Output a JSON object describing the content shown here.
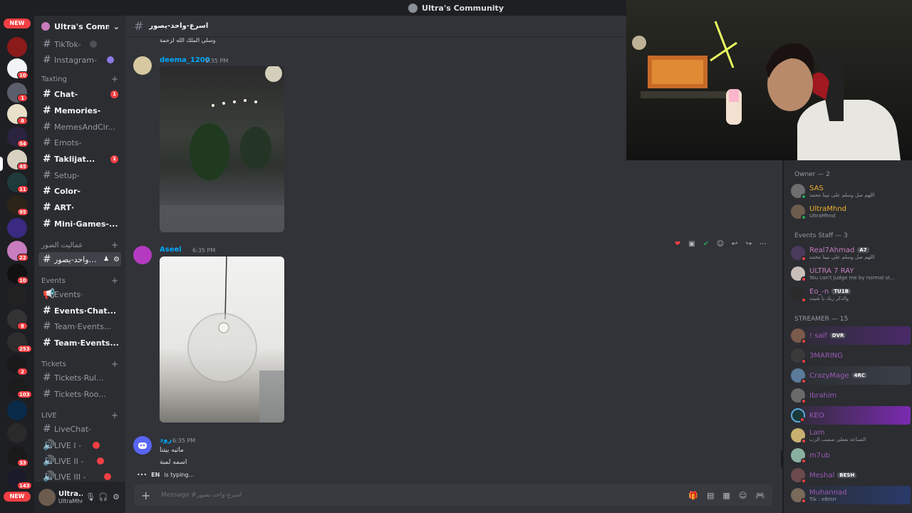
{
  "window": {
    "title": "Ultra's Community"
  },
  "rail": {
    "new_label": "NEW",
    "badges": [
      "10",
      "1",
      "8",
      "54",
      "45",
      "11",
      "95",
      "22",
      "10",
      "8",
      "253",
      "2",
      "103",
      "33",
      "143"
    ]
  },
  "server": {
    "name": "Ultra's Comm..."
  },
  "channels": {
    "tiktok": "TikTok-",
    "instagram": "Instagram-",
    "cat_texting": "Taxting",
    "chat": "Chat-",
    "chat_badge": "1",
    "memories": "Memories-",
    "memes": "MemesAndCir...",
    "emots": "Emots-",
    "taklijat": "Taklijat...",
    "taklijat_badge": "1",
    "setup": "Setup-",
    "color": "Color-",
    "art": "ART·",
    "mini_games": "Mini·Games-...",
    "cat_photos": "عماليت الصور",
    "active_channel": "اسرع-واحد-يصور",
    "cat_events": "Events",
    "events": "Events·",
    "events_chat": "Events·Chat...",
    "team_events_1": "Team·Events...",
    "team_events_2": "Team·Events...",
    "cat_tickets": "Tickets",
    "tickets_rules": "Tickets·Rul...",
    "tickets_room": "Tickets·Roo...",
    "cat_live": "LIVE",
    "livechat": "LiveChat-",
    "live1": "LIVE I -",
    "live2": "LIVE II -",
    "live3": "LIVE III -"
  },
  "user": {
    "display": "Ultra...",
    "username": "UltraMhnd"
  },
  "channel_header": {
    "name": "اسرع-واحد-يصور"
  },
  "messages": {
    "prev_text": "وسلي الملك الله لزحمة",
    "m1": {
      "author": "deema_1200",
      "time": "6:35 PM"
    },
    "m2": {
      "author": "Aseel",
      "time": "6:35 PM"
    },
    "m3": {
      "author": "زود",
      "time": "6:35 PM",
      "line1": "ماتيه بيتنا",
      "line2": "اسمه لمبة"
    }
  },
  "typing": {
    "who": "EN",
    "text": "is typing..."
  },
  "composer": {
    "placeholder": "Message #اسرع-واحد-يصور"
  },
  "members": {
    "owner_header": "Owner — 2",
    "owner": [
      {
        "name": "SAS",
        "status": "اللهم صل وسلم على نبينا محمد",
        "color": "#f0b232"
      },
      {
        "name": "UltraMhnd",
        "status": "UltraMhnd",
        "color": "#f0b232"
      }
    ],
    "staff_header": "Events Staff — 3",
    "staff": [
      {
        "name": "Real7Ahmad",
        "tag": "A7",
        "status": "اللهم صل وسلم على نبينا محمد",
        "color": "#c77dbe"
      },
      {
        "name": "ULTRA 7 RAY",
        "status": "You can't judge me by normal st...",
        "color": "#c77dbe"
      },
      {
        "name": "Eo_-n",
        "tag": "TU1B",
        "status": "والذكر ربك يا شيت",
        "color": "#c77dbe"
      }
    ],
    "streamer_header": "STREAMER — 15",
    "streamers": [
      {
        "name": "! saif",
        "tag": "DVR",
        "status": "",
        "color": "#9b59b6"
      },
      {
        "name": "3MARING",
        "status": "",
        "color": "#9b59b6"
      },
      {
        "name": "CrazyMage",
        "tag": "4RC",
        "status": "",
        "color": "#9b59b6"
      },
      {
        "name": "Ibrahim",
        "status": "",
        "color": "#9b59b6"
      },
      {
        "name": "KEO",
        "status": "",
        "color": "#9b59b6"
      },
      {
        "name": "Lam",
        "status": "الصناعة تعطي صصب الرب",
        "color": "#9b59b6"
      },
      {
        "name": "m7ub",
        "status": "",
        "color": "#9b59b6"
      },
      {
        "name": "Meshal",
        "tag": "BESH",
        "status": "",
        "color": "#9b59b6"
      },
      {
        "name": "Muhannad",
        "status": "Tik : e8mrr",
        "color": "#9b59b6"
      }
    ]
  },
  "colors": {
    "accent": "#5865f2",
    "danger": "#f23f43",
    "online": "#23a55a",
    "link": "#00a8fc"
  }
}
